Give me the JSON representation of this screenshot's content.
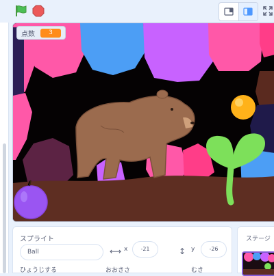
{
  "toolbar": {
    "green_flag": "green-flag-icon",
    "stop": "stop-sign-icon",
    "small_stage": "small-stage-layout-icon",
    "large_stage": "large-stage-layout-icon",
    "fullscreen": "fullscreen-icon"
  },
  "monitor": {
    "label": "点数",
    "value": "3"
  },
  "sprite_info": {
    "heading": "スプライト",
    "name": "Ball",
    "x_label": "x",
    "x_value": "-21",
    "y_label": "y",
    "y_value": "-26",
    "show_label": "ひょうじする",
    "size_label": "おおきさ",
    "direction_label": "むき"
  },
  "stage_selector": {
    "heading": "ステージ"
  },
  "colors": {
    "accent": "#855cd6",
    "monitor_value_bg": "#ff8c1a",
    "flag": "#4cbf56",
    "stop": "#ec5959"
  }
}
